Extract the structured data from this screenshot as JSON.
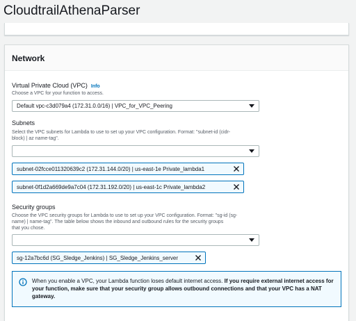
{
  "page": {
    "title": "CloudtrailAthenaParser"
  },
  "network": {
    "title": "Network",
    "vpc": {
      "label": "Virtual Private Cloud (VPC)",
      "info": "Info",
      "description": "Choose a VPC for your function to access.",
      "selected": "Default vpc-c3d079a4 (172.31.0.0/16) | VPC_for_VPC_Peering"
    },
    "subnets": {
      "label": "Subnets",
      "description_1": "Select the VPC subnets for Lambda to use to set up your VPC configuration. Format: \"subnet-id (cidr-",
      "description_2": "block) | az name-tag\".",
      "selected": "",
      "tokens": [
        "subnet-02fcce011320639c2 (172.31.144.0/20) | us-east-1e Private_lambda1",
        "subnet-0f1d2a669de9a7c04 (172.31.192.0/20) | us-east-1c Private_lambda2"
      ]
    },
    "security_groups": {
      "label": "Security groups",
      "description_1": "Choose the VPC security groups for Lambda to use to set up your VPC configuration. Format: \"sg-id (sg-",
      "description_2": "name) | name-tag\". The table below shows the inbound and outbound rules for the security groups",
      "description_3": "that you chose.",
      "selected": "",
      "tokens": [
        "sg-12a7bc6d (SG_Sledge_Jenkins) | SG_Sledge_Jenkins_server"
      ]
    },
    "alert": {
      "plain": "When you enable a VPC, your Lambda function loses default internet access.",
      "bold": "If you require external internet access for your function, make sure that your security group allows outbound connections and that your VPC has a NAT gateway."
    }
  },
  "colors": {
    "accent": "#0073bb",
    "token_bg": "#f1faff",
    "background": "#f2f3f3"
  },
  "icons": {
    "remove": "close-icon",
    "dropdown": "caret-down-icon",
    "alert": "info-circle-icon"
  }
}
